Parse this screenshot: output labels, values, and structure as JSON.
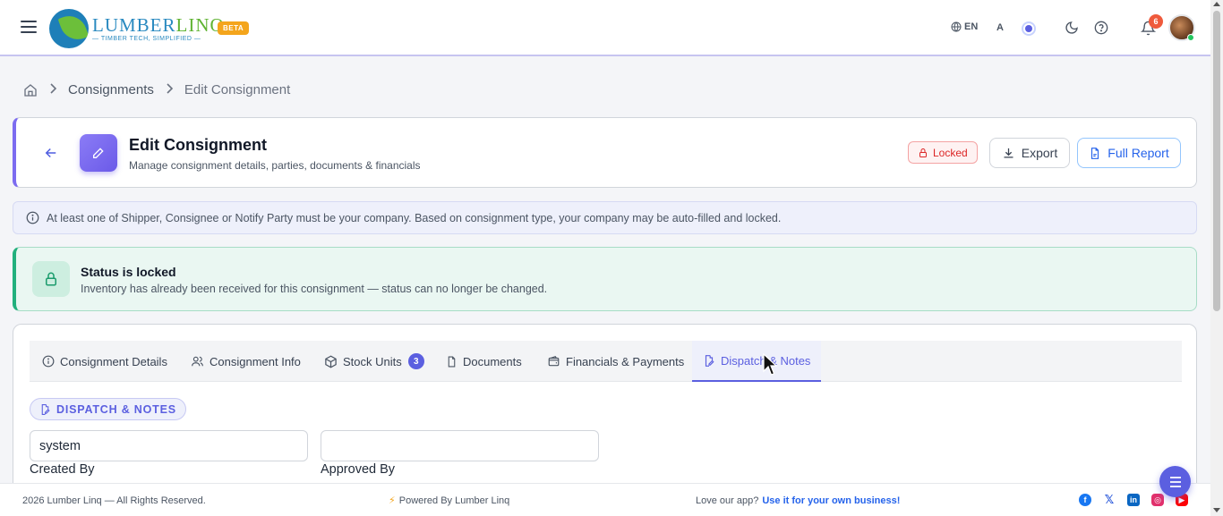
{
  "app": {
    "logo_name_a": "LUMBER",
    "logo_name_b": "LINQ",
    "logo_tagline": "— TIMBER TECH, SIMPLIFIED —",
    "beta_label": "BETA"
  },
  "topbar": {
    "language": "EN",
    "font_toggle": "A",
    "notification_count": "6"
  },
  "breadcrumb": {
    "items": [
      "Consignments",
      "Edit Consignment"
    ]
  },
  "header": {
    "title": "Edit Consignment",
    "subtitle": "Manage consignment details, parties, documents & financials",
    "locked_label": "Locked",
    "export_label": "Export",
    "report_label": "Full Report",
    "accent_color": "#7c6cf0"
  },
  "info_banner": {
    "text": "At least one of Shipper, Consignee or Notify Party must be your company. Based on consignment type, your company may be auto-filled and locked."
  },
  "status": {
    "title": "Status is locked",
    "description": "Inventory has already been received for this consignment — status can no longer be changed.",
    "color": "#22b07d"
  },
  "tabs": [
    {
      "label": "Consignment Details",
      "icon": "info-icon"
    },
    {
      "label": "Consignment Info",
      "icon": "users-icon"
    },
    {
      "label": "Stock Units",
      "icon": "box-icon",
      "badge": "3"
    },
    {
      "label": "Documents",
      "icon": "file-icon"
    },
    {
      "label": "Financials & Payments",
      "icon": "wallet-icon"
    },
    {
      "label": "Dispatch & Notes",
      "icon": "edit-file-icon",
      "active": true
    }
  ],
  "dispatch": {
    "section_label": "DISPATCH & NOTES",
    "created_by_value": "system",
    "created_by_label": "Created By",
    "approved_by_value": "",
    "approved_by_label": "Approved By"
  },
  "footer": {
    "copyright": "2026 Lumber Linq — All Rights Reserved.",
    "powered": "Powered By Lumber Linq",
    "love_text": "Love our app?",
    "love_link": "Use it for your own business!",
    "socials": [
      "facebook-icon",
      "x-icon",
      "linkedin-icon",
      "instagram-icon",
      "youtube-icon"
    ]
  },
  "colors": {
    "primary": "#5b5fe0",
    "danger": "#dc2626",
    "link": "#2563eb"
  }
}
